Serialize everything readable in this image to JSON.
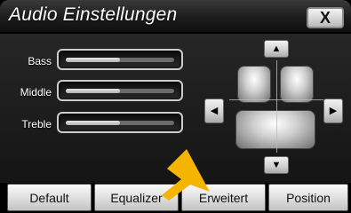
{
  "window": {
    "title": "Audio Einstellungen",
    "close_label": "X"
  },
  "sliders": [
    {
      "label": "Bass",
      "level": 0.5
    },
    {
      "label": "Middle",
      "level": 0.5
    },
    {
      "label": "Treble",
      "level": 0.5
    }
  ],
  "fader": {
    "up_icon": "up-arrow-icon",
    "down_icon": "down-arrow-icon",
    "left_icon": "left-arrow-icon",
    "right_icon": "right-arrow-icon"
  },
  "tabs": [
    {
      "label": "Default"
    },
    {
      "label": "Equalizer"
    },
    {
      "label": "Erweitert"
    },
    {
      "label": "Position"
    }
  ],
  "colors": {
    "pointer": "#f5b400",
    "background": "#1a1a1a"
  }
}
